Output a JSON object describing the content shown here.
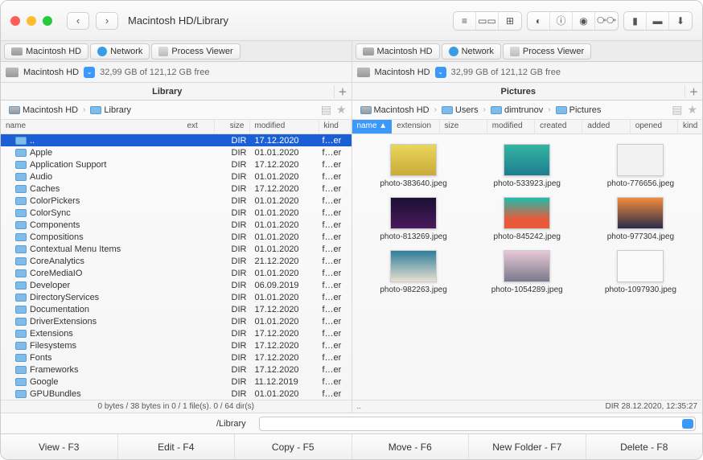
{
  "window": {
    "title": "Macintosh HD/Library"
  },
  "toolbar": {
    "view_mode_list": "≡",
    "view_mode_cols": "⫼",
    "view_mode_icons": "⊞"
  },
  "left": {
    "tabs": [
      {
        "label": "Macintosh HD",
        "kind": "hd"
      },
      {
        "label": "Network",
        "kind": "net"
      },
      {
        "label": "Process Viewer",
        "kind": "pv"
      }
    ],
    "drive": {
      "name": "Macintosh HD",
      "free": "32,99 GB of 121,12 GB free"
    },
    "header": "Library",
    "breadcrumb": [
      {
        "label": "Macintosh HD",
        "kind": "hd"
      },
      {
        "label": "Library",
        "kind": "folder"
      }
    ],
    "columns": {
      "name": "name",
      "ext": "ext",
      "size": "size",
      "modified": "modified",
      "kind": "kind"
    },
    "files": [
      {
        "name": "..",
        "size": "DIR",
        "modified": "17.12.2020",
        "kind": "f…er",
        "sel": true
      },
      {
        "name": "Apple",
        "size": "DIR",
        "modified": "01.01.2020",
        "kind": "f…er"
      },
      {
        "name": "Application Support",
        "size": "DIR",
        "modified": "17.12.2020",
        "kind": "f…er"
      },
      {
        "name": "Audio",
        "size": "DIR",
        "modified": "01.01.2020",
        "kind": "f…er"
      },
      {
        "name": "Caches",
        "size": "DIR",
        "modified": "17.12.2020",
        "kind": "f…er"
      },
      {
        "name": "ColorPickers",
        "size": "DIR",
        "modified": "01.01.2020",
        "kind": "f…er"
      },
      {
        "name": "ColorSync",
        "size": "DIR",
        "modified": "01.01.2020",
        "kind": "f…er"
      },
      {
        "name": "Components",
        "size": "DIR",
        "modified": "01.01.2020",
        "kind": "f…er"
      },
      {
        "name": "Compositions",
        "size": "DIR",
        "modified": "01.01.2020",
        "kind": "f…er"
      },
      {
        "name": "Contextual Menu Items",
        "size": "DIR",
        "modified": "01.01.2020",
        "kind": "f…er"
      },
      {
        "name": "CoreAnalytics",
        "size": "DIR",
        "modified": "21.12.2020",
        "kind": "f…er"
      },
      {
        "name": "CoreMediaIO",
        "size": "DIR",
        "modified": "01.01.2020",
        "kind": "f…er"
      },
      {
        "name": "Developer",
        "size": "DIR",
        "modified": "06.09.2019",
        "kind": "f…er"
      },
      {
        "name": "DirectoryServices",
        "size": "DIR",
        "modified": "01.01.2020",
        "kind": "f…er"
      },
      {
        "name": "Documentation",
        "size": "DIR",
        "modified": "17.12.2020",
        "kind": "f…er"
      },
      {
        "name": "DriverExtensions",
        "size": "DIR",
        "modified": "01.01.2020",
        "kind": "f…er"
      },
      {
        "name": "Extensions",
        "size": "DIR",
        "modified": "17.12.2020",
        "kind": "f…er"
      },
      {
        "name": "Filesystems",
        "size": "DIR",
        "modified": "17.12.2020",
        "kind": "f…er"
      },
      {
        "name": "Fonts",
        "size": "DIR",
        "modified": "17.12.2020",
        "kind": "f…er"
      },
      {
        "name": "Frameworks",
        "size": "DIR",
        "modified": "17.12.2020",
        "kind": "f…er"
      },
      {
        "name": "Google",
        "size": "DIR",
        "modified": "11.12.2019",
        "kind": "f…er"
      },
      {
        "name": "GPUBundles",
        "size": "DIR",
        "modified": "01.01.2020",
        "kind": "f…er"
      }
    ],
    "status": "0 bytes / 38 bytes in 0 / 1 file(s). 0 / 64 dir(s)"
  },
  "right": {
    "tabs": [
      {
        "label": "Macintosh HD",
        "kind": "hd"
      },
      {
        "label": "Network",
        "kind": "net"
      },
      {
        "label": "Process Viewer",
        "kind": "pv"
      }
    ],
    "drive": {
      "name": "Macintosh HD",
      "free": "32,99 GB of 121,12 GB free"
    },
    "header": "Pictures",
    "breadcrumb": [
      {
        "label": "Macintosh HD",
        "kind": "hd"
      },
      {
        "label": "Users",
        "kind": "folder"
      },
      {
        "label": "dimtrunov",
        "kind": "folder"
      },
      {
        "label": "Pictures",
        "kind": "folder"
      }
    ],
    "columns": {
      "name": "name ▲",
      "extension": "extension",
      "size": "size",
      "modified": "modified",
      "created": "created",
      "added": "added",
      "opened": "opened",
      "kind": "kind"
    },
    "thumbs": [
      {
        "label": "photo-383640.jpeg"
      },
      {
        "label": "photo-533923.jpeg"
      },
      {
        "label": "photo-776656.jpeg"
      },
      {
        "label": "photo-813269.jpeg"
      },
      {
        "label": "photo-845242.jpeg"
      },
      {
        "label": "photo-977304.jpeg"
      },
      {
        "label": "photo-982263.jpeg"
      },
      {
        "label": "photo-1054289.jpeg"
      },
      {
        "label": "photo-1097930.jpeg"
      }
    ],
    "status_left": "..",
    "status_right": "DIR   28.12.2020, 12:35:27"
  },
  "path": {
    "label": "/Library"
  },
  "bottom": [
    "View - F3",
    "Edit - F4",
    "Copy - F5",
    "Move - F6",
    "New Folder - F7",
    "Delete - F8"
  ]
}
